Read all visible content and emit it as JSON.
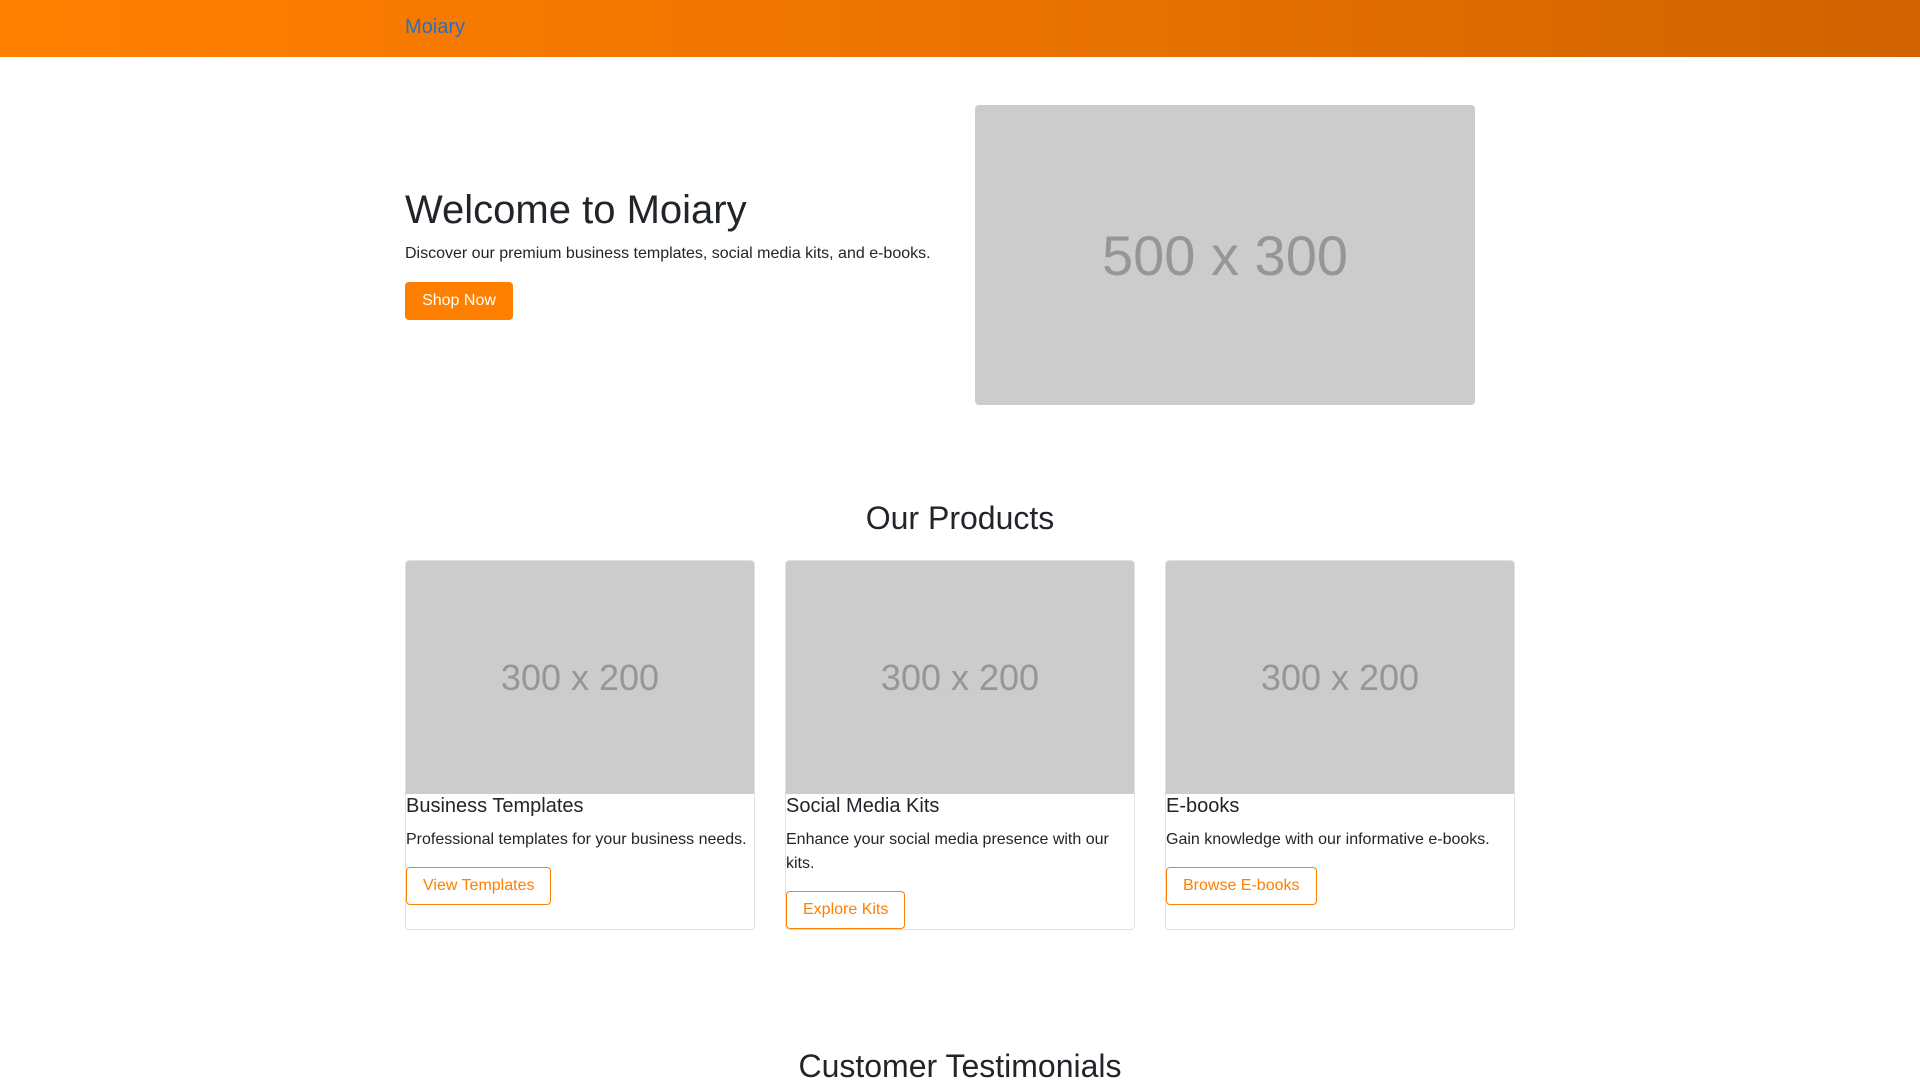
{
  "navbar": {
    "brand": "Moiary"
  },
  "hero": {
    "title": "Welcome to Moiary",
    "subtitle": "Discover our premium business templates, social media kits, and e-books.",
    "cta_label": "Shop Now",
    "image_placeholder": "500 x 300"
  },
  "products": {
    "section_title": "Our Products",
    "items": [
      {
        "image_placeholder": "300 x 200",
        "title": "Business Templates",
        "description": "Professional templates for your business needs.",
        "button_label": "View Templates"
      },
      {
        "image_placeholder": "300 x 200",
        "title": "Social Media Kits",
        "description": "Enhance your social media presence with our kits.",
        "button_label": "Explore Kits"
      },
      {
        "image_placeholder": "300 x 200",
        "title": "E-books",
        "description": "Gain knowledge with our informative e-books.",
        "button_label": "Browse E-books"
      }
    ]
  },
  "testimonials": {
    "section_title": "Customer Testimonials"
  },
  "colors": {
    "accent": "#ff7f00",
    "navbar_gradient_start": "#ff7f00",
    "navbar_gradient_end": "#d06300",
    "brand_link": "#2a6fc4",
    "placeholder_bg": "#cccccc",
    "placeholder_text": "#969696"
  }
}
